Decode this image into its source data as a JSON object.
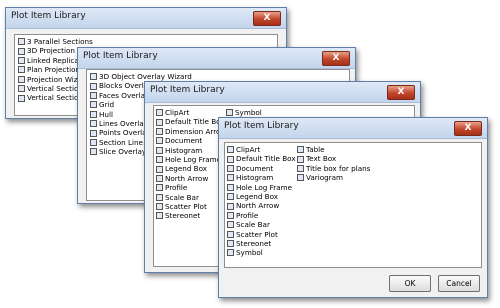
{
  "windows": [
    {
      "title": "Plot Item Library",
      "close_label": "X",
      "columns": [
        [
          "3 Parallel Sections",
          "3D Projection",
          "Linked Replica",
          "Plan Projection",
          "Projection Wizard",
          "Vertical Section",
          "Vertical Section"
        ]
      ]
    },
    {
      "title": "Plot Item Library",
      "close_label": "X",
      "columns": [
        [
          "3D Object Overlay Wizard",
          "Blocks Overlay",
          "Faces Overlay",
          "Grid",
          "Hull",
          "Lines Overlay",
          "Points Overlay",
          "Section Line",
          "Slice Overlay"
        ]
      ]
    },
    {
      "title": "Plot Item Library",
      "close_label": "X",
      "columns": [
        [
          "ClipArt",
          "Default Title Box",
          "Dimension Arrow",
          "Document",
          "Histogram",
          "Hole Log Frame",
          "Legend Box",
          "North Arrow",
          "Profile",
          "Scale Bar",
          "Scatter Plot",
          "Stereonet"
        ],
        [
          "Symbol"
        ]
      ]
    },
    {
      "title": "Plot Item Library",
      "close_label": "X",
      "columns": [
        [
          "ClipArt",
          "Default Title Box",
          "Document",
          "Histogram",
          "Hole Log Frame",
          "Legend Box",
          "North Arrow",
          "Profile",
          "Scale Bar",
          "Scatter Plot",
          "Stereonet",
          "Symbol"
        ],
        [
          "Table",
          "Text Box",
          "Title box for plans",
          "Variogram"
        ]
      ],
      "ok_label": "OK",
      "cancel_label": "Cancel"
    }
  ],
  "colors": {
    "titlebar": "#c3d5ec",
    "close_button": "#c0462b",
    "window_border": "#5d7fa8",
    "window_bg": "#f1f1f1",
    "list_bg": "#ffffff"
  }
}
